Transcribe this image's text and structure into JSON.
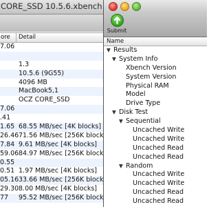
{
  "back_window": {
    "title": "CORE_SSD 10.5.6.xbench",
    "columns": {
      "score": "ore",
      "detail": "Detail"
    },
    "rows": [
      {
        "score": "7.06",
        "detail": ""
      },
      {
        "score": "",
        "detail": ""
      },
      {
        "score": "",
        "detail": "1.3"
      },
      {
        "score": "",
        "detail": "10.5.6 (9G55)"
      },
      {
        "score": "",
        "detail": "4096 MB"
      },
      {
        "score": "",
        "detail": "MacBook5,1"
      },
      {
        "score": "",
        "detail": "OCZ CORE_SSD"
      },
      {
        "score": "7.06",
        "detail": ""
      },
      {
        "score": ".41",
        "detail": ""
      },
      {
        "score": "1.65",
        "detail": "68.55 MB/sec [4K blocks]"
      },
      {
        "score": "26.46",
        "detail": "71.56 MB/sec [256K blocks]"
      },
      {
        "score": "7.84",
        "detail": "9.61 MB/sec [4K blocks]"
      },
      {
        "score": "59.06",
        "detail": "84.97 MB/sec [256K blocks]"
      },
      {
        "score": "0.55",
        "detail": ""
      },
      {
        "score": "0.51",
        "detail": "1.97 MB/sec [4K blocks]"
      },
      {
        "score": "05.16",
        "detail": "33.66 MB/sec [256K blocks]"
      },
      {
        "score": "29.30",
        "detail": "8.00 MB/sec [4K blocks]"
      },
      {
        "score": "77",
        "detail": "95.52 MB/sec [256K blocks]"
      }
    ]
  },
  "front_window": {
    "toolbar": {
      "submit_label": "Submit"
    },
    "column_header": "Name",
    "tree": [
      {
        "label": "Results",
        "level": 0,
        "arrow": "down"
      },
      {
        "label": "System Info",
        "level": 1,
        "arrow": "down"
      },
      {
        "label": "Xbench Version",
        "level": 2,
        "arrow": ""
      },
      {
        "label": "System Version",
        "level": 2,
        "arrow": ""
      },
      {
        "label": "Physical RAM",
        "level": 2,
        "arrow": ""
      },
      {
        "label": "Model",
        "level": 2,
        "arrow": ""
      },
      {
        "label": "Drive Type",
        "level": 2,
        "arrow": ""
      },
      {
        "label": "Disk Test",
        "level": 1,
        "arrow": "down"
      },
      {
        "label": "Sequential",
        "level": 2,
        "arrow": "down"
      },
      {
        "label": "Uncached Write",
        "level": 3,
        "arrow": ""
      },
      {
        "label": "Uncached Write",
        "level": 3,
        "arrow": ""
      },
      {
        "label": "Uncached Read",
        "level": 3,
        "arrow": ""
      },
      {
        "label": "Uncached Read",
        "level": 3,
        "arrow": ""
      },
      {
        "label": "Random",
        "level": 2,
        "arrow": "down"
      },
      {
        "label": "Uncached Write",
        "level": 3,
        "arrow": ""
      },
      {
        "label": "Uncached Write",
        "level": 3,
        "arrow": ""
      },
      {
        "label": "Uncached Read",
        "level": 3,
        "arrow": ""
      },
      {
        "label": "Uncached Read",
        "level": 3,
        "arrow": ""
      }
    ]
  }
}
